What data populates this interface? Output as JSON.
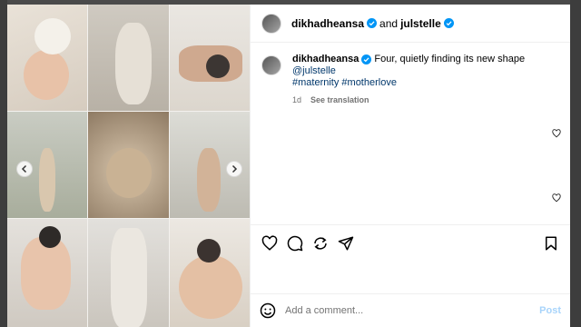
{
  "header": {
    "username": "dikhadheansa",
    "conjunction": "and",
    "collaborator": "julstelle"
  },
  "caption": {
    "username": "dikhadheansa",
    "text": "Four, quietly finding its new shape",
    "mention": "@julstelle",
    "hashtags": "#maternity #motherlove",
    "time": "1d",
    "see_translation": "See translation"
  },
  "media": {
    "photos": [
      "pregnant-belly-white-top",
      "pregnant-silhouette-closeup",
      "family-on-bed",
      "mother-standing-garden",
      "hands-on-belly-gold",
      "mother-leaning-window",
      "mother-holding-child",
      "child-holding-mother-legs",
      "daughter-hugging-belly"
    ]
  },
  "actions": {
    "icons": [
      "heart-icon",
      "comment-icon",
      "share-icon",
      "send-icon",
      "bookmark-icon"
    ]
  },
  "comment_box": {
    "placeholder": "Add a comment...",
    "post_label": "Post"
  },
  "colors": {
    "link": "#00376b",
    "verified": "#0095f6",
    "post_disabled": "#a8d4fb",
    "meta": "#737373"
  }
}
